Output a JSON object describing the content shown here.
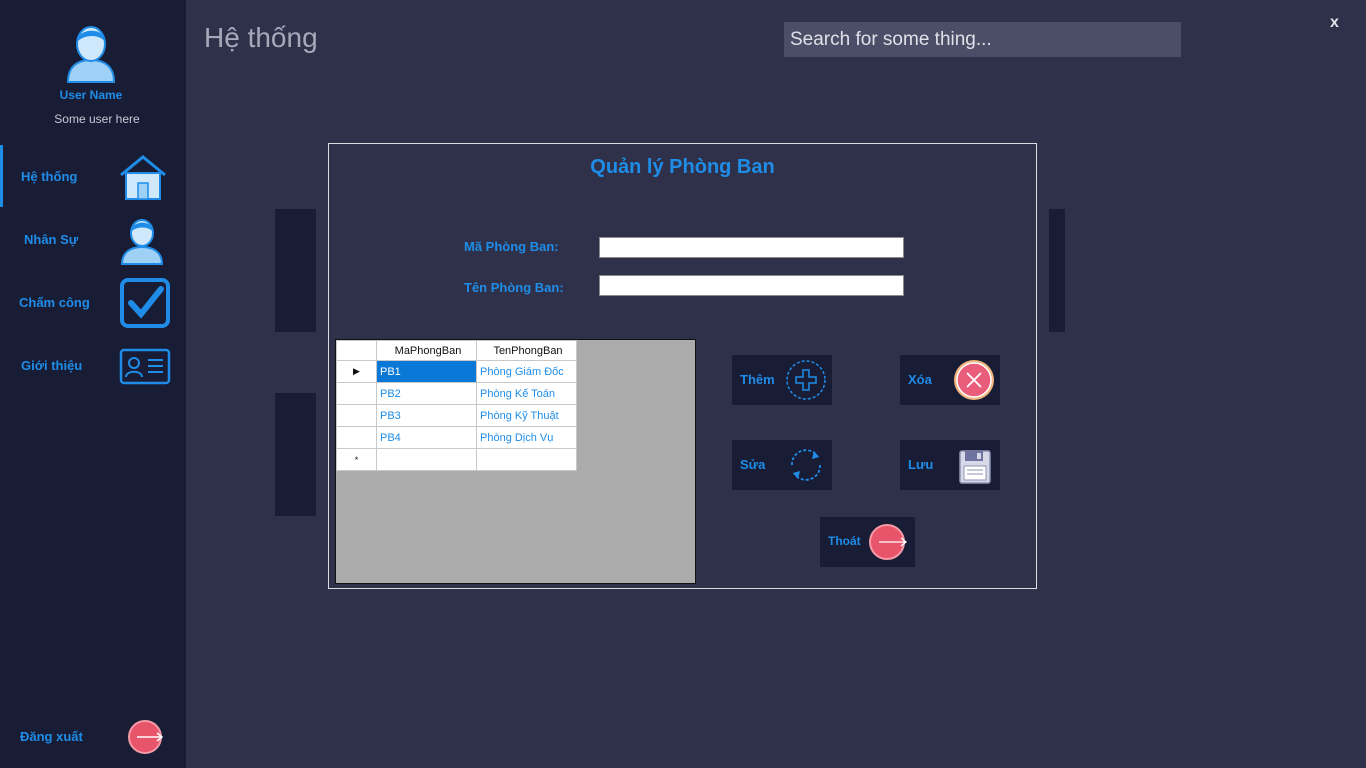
{
  "sidebar": {
    "user_name": "User Name",
    "user_subtitle": "Some user here",
    "items": [
      {
        "label": "Hệ thống",
        "icon": "home-icon"
      },
      {
        "label": "Nhân Sự",
        "icon": "user-icon"
      },
      {
        "label": "Chấm công",
        "icon": "checkbox-icon"
      },
      {
        "label": "Giới thiệu",
        "icon": "id-card-icon"
      }
    ],
    "logout_label": "Đăng xuất"
  },
  "header": {
    "title": "Hệ thống",
    "search_placeholder": "Search for some thing...",
    "close_label": "x"
  },
  "panel": {
    "title": "Quản lý Phòng Ban",
    "field_ma_label": "Mã Phòng Ban:",
    "field_ten_label": "Tên Phòng Ban:",
    "field_ma_value": "",
    "field_ten_value": ""
  },
  "grid": {
    "columns": [
      "MaPhongBan",
      "TenPhongBan"
    ],
    "rows": [
      {
        "ma": "PB1",
        "ten": "Phòng Giám Đốc"
      },
      {
        "ma": "PB2",
        "ten": "Phòng Kế Toán"
      },
      {
        "ma": "PB3",
        "ten": "Phòng Kỹ Thuật"
      },
      {
        "ma": "PB4",
        "ten": "Phòng Dịch Vụ"
      }
    ],
    "new_row_marker": "*",
    "current_row_marker": "▶"
  },
  "actions": {
    "them": "Thêm",
    "xoa": "Xóa",
    "sua": "Sửa",
    "luu": "Lưu",
    "thoat": "Thoát"
  },
  "colors": {
    "accent": "#1f8de8",
    "sidebar_bg": "#181c35",
    "main_bg": "#2e3149",
    "danger": "#e8546a"
  }
}
